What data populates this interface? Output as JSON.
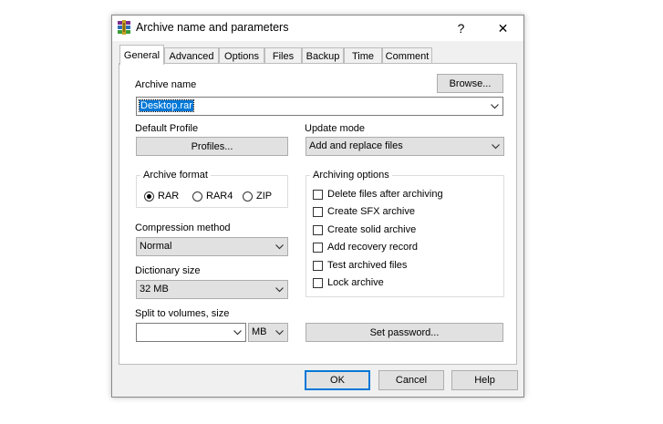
{
  "window": {
    "title": "Archive name and parameters",
    "help_glyph": "?",
    "close_glyph": "✕"
  },
  "tabs": [
    {
      "label": "General",
      "active": true
    },
    {
      "label": "Advanced"
    },
    {
      "label": "Options"
    },
    {
      "label": "Files"
    },
    {
      "label": "Backup"
    },
    {
      "label": "Time"
    },
    {
      "label": "Comment"
    }
  ],
  "general": {
    "archive_name_label": "Archive name",
    "archive_name_value": "Desktop.rar",
    "browse_label": "Browse...",
    "default_profile_label": "Default Profile",
    "profiles_button": "Profiles...",
    "update_mode_label": "Update mode",
    "update_mode_value": "Add and replace files",
    "archive_format_label": "Archive format",
    "formats": [
      {
        "label": "RAR",
        "selected": true
      },
      {
        "label": "RAR4",
        "selected": false
      },
      {
        "label": "ZIP",
        "selected": false
      }
    ],
    "compression_label": "Compression method",
    "compression_value": "Normal",
    "dictionary_label": "Dictionary size",
    "dictionary_value": "32 MB",
    "split_label": "Split to volumes, size",
    "split_value": "",
    "split_unit": "MB",
    "archiving_options_label": "Archiving options",
    "options": [
      {
        "label": "Delete files after archiving",
        "checked": false
      },
      {
        "label": "Create SFX archive",
        "checked": false
      },
      {
        "label": "Create solid archive",
        "checked": false
      },
      {
        "label": "Add recovery record",
        "checked": false
      },
      {
        "label": "Test archived files",
        "checked": false
      },
      {
        "label": "Lock archive",
        "checked": false
      }
    ],
    "set_password_button": "Set password..."
  },
  "footer": {
    "ok": "OK",
    "cancel": "Cancel",
    "help": "Help"
  },
  "colors": {
    "accent": "#0078d7",
    "dialog_bg": "#f0f0f0",
    "button_bg": "#e1e1e1"
  }
}
